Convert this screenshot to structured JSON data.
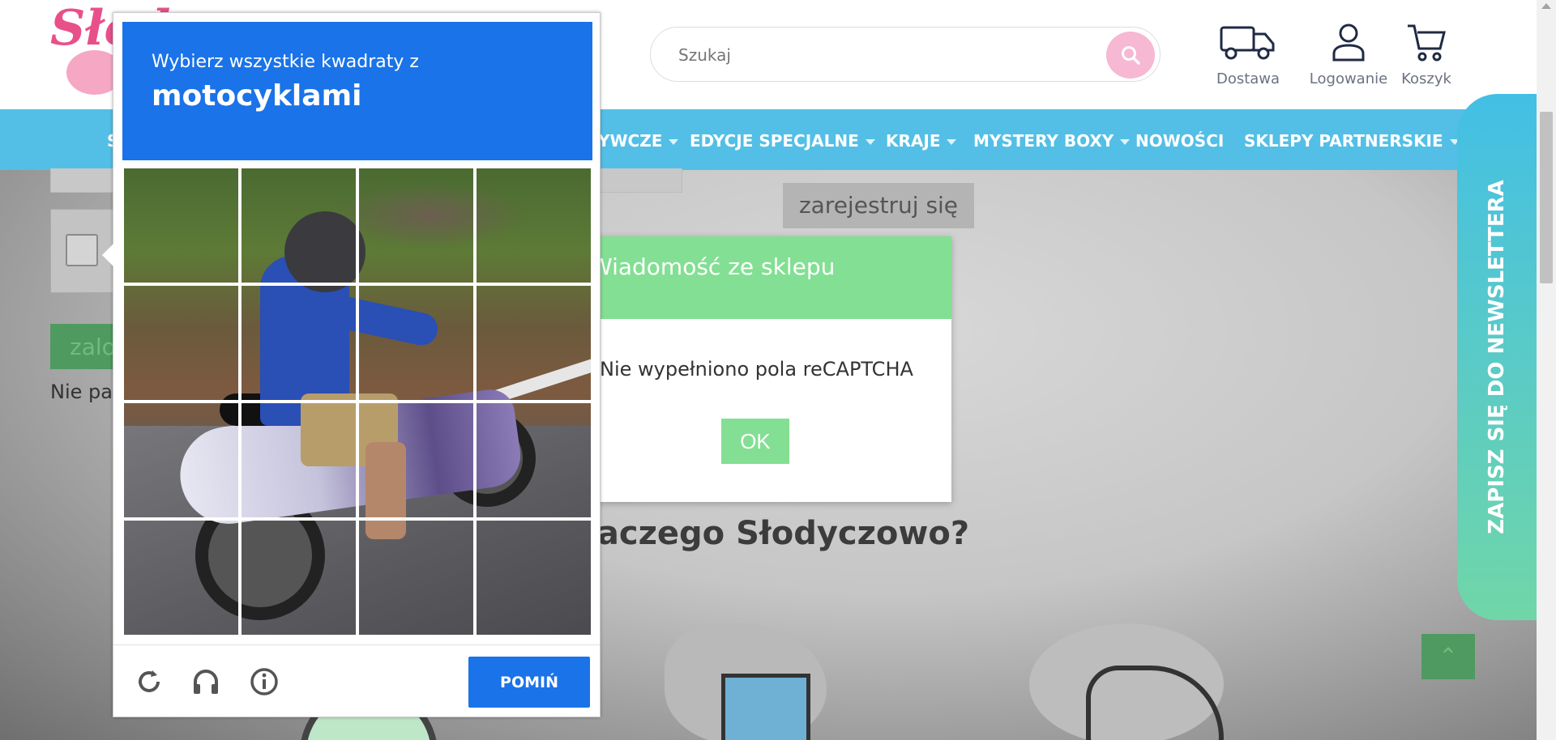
{
  "header": {
    "search": {
      "placeholder": "Szukaj"
    },
    "icons": [
      {
        "label": "Dostawa",
        "icon": "truck-icon"
      },
      {
        "label": "Logowanie",
        "icon": "user-icon"
      },
      {
        "label": "Koszyk",
        "icon": "cart-icon"
      }
    ]
  },
  "nav": {
    "items": [
      {
        "label": "S"
      },
      {
        "label": "YWCZE"
      },
      {
        "label": "EDYCJE SPECJALNE"
      },
      {
        "label": "KRAJE"
      },
      {
        "label": "MYSTERY BOXY"
      },
      {
        "label": "NOWOŚCI"
      },
      {
        "label": "SKLEPY PARTNERSKIE"
      }
    ]
  },
  "page": {
    "login_button": "zalo",
    "forgot_text": "Nie pa",
    "register_button": "zarejestruj się",
    "why_heading": "Dlaczego Słodyczowo?"
  },
  "newsletter": {
    "label": "ZAPISZ SIĘ DO NEWSLETTERA"
  },
  "shop_message": {
    "title": "Wiadomość ze sklepu",
    "text": "Nie wypełniono pola reCAPTCHA",
    "ok_label": "OK"
  },
  "captcha": {
    "instruction": "Wybierz wszystkie kwadraty z",
    "target": "motocyklami",
    "grid": {
      "rows": 4,
      "cols": 4
    },
    "skip_label": "POMIŃ",
    "footer_icons": [
      "reload-icon",
      "headphones-icon",
      "info-icon"
    ]
  },
  "colors": {
    "captcha_blue": "#1a73e8",
    "nav_blue": "#53bfe6",
    "shop_green": "#83df93"
  }
}
